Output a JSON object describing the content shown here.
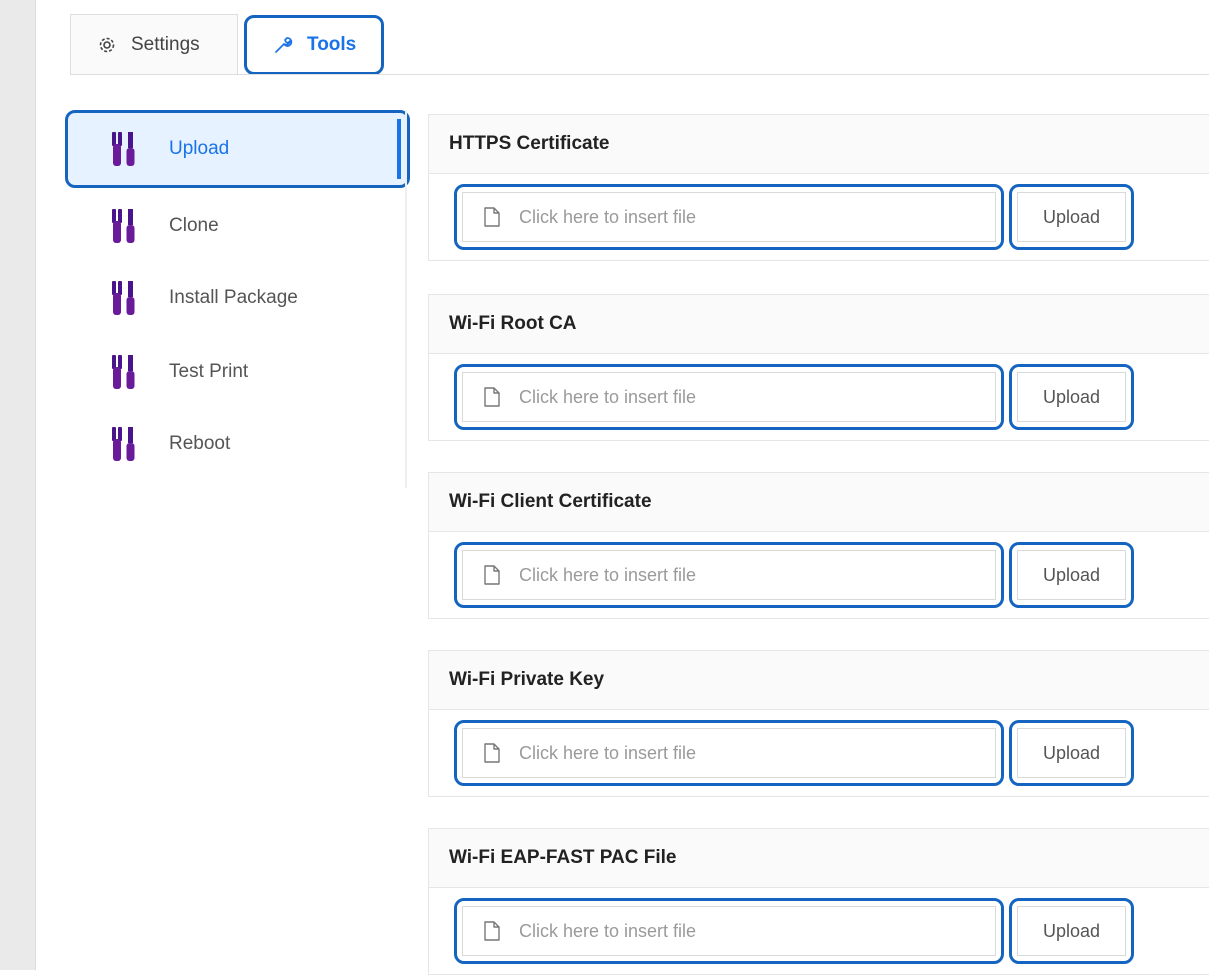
{
  "tabs": [
    {
      "label": "Settings",
      "icon": "gear-icon",
      "active": false
    },
    {
      "label": "Tools",
      "icon": "wrench-icon",
      "active": true
    }
  ],
  "sidebar": {
    "items": [
      {
        "label": "Upload",
        "icon": "tools-icon",
        "active": true
      },
      {
        "label": "Clone",
        "icon": "tools-icon",
        "active": false
      },
      {
        "label": "Install Package",
        "icon": "tools-icon",
        "active": false
      },
      {
        "label": "Test Print",
        "icon": "tools-icon",
        "active": false
      },
      {
        "label": "Reboot",
        "icon": "tools-icon",
        "active": false
      }
    ]
  },
  "sections": [
    {
      "title": "HTTPS Certificate",
      "placeholder": "Click here to insert file",
      "button": "Upload"
    },
    {
      "title": "Wi-Fi Root CA",
      "placeholder": "Click here to insert file",
      "button": "Upload"
    },
    {
      "title": "Wi-Fi Client Certificate",
      "placeholder": "Click here to insert file",
      "button": "Upload"
    },
    {
      "title": "Wi-Fi Private Key",
      "placeholder": "Click here to insert file",
      "button": "Upload"
    },
    {
      "title": "Wi-Fi EAP-FAST PAC File",
      "placeholder": "Click here to insert file",
      "button": "Upload"
    }
  ],
  "colors": {
    "accent": "#1a73e8",
    "highlight_border": "#1565c0",
    "active_bg": "#e6f2ff",
    "tool_icon": "#6a1b9a"
  }
}
